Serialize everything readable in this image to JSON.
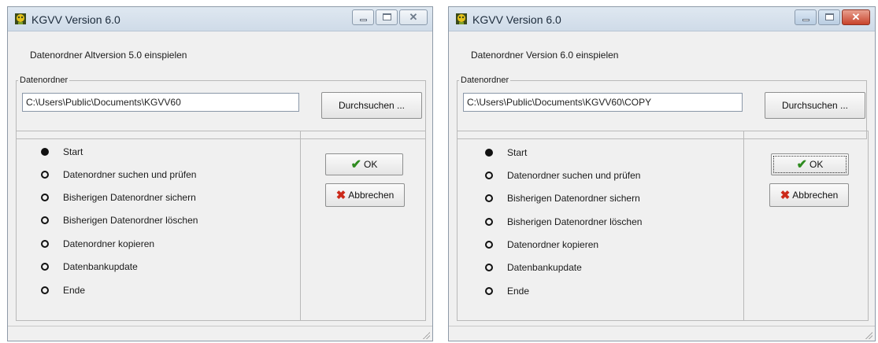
{
  "windows": [
    {
      "title": "KGVV Version 6.0",
      "subtitle": "Datenordner Altversion 5.0 einspielen",
      "group_label": "Datenordner",
      "folder_path": "C:\\Users\\Public\\Documents\\KGVV60",
      "browse_label": "Durchsuchen ...",
      "ok_label": "OK",
      "cancel_label": "Abbrechen",
      "steps": [
        {
          "label": "Start",
          "active": true
        },
        {
          "label": "Datenordner suchen und prüfen",
          "active": false
        },
        {
          "label": "Bisherigen Datenordner sichern",
          "active": false
        },
        {
          "label": "Bisherigen Datenordner löschen",
          "active": false
        },
        {
          "label": "Datenordner kopieren",
          "active": false
        },
        {
          "label": "Datenbankupdate",
          "active": false
        },
        {
          "label": "Ende",
          "active": false
        }
      ]
    },
    {
      "title": "KGVV Version 6.0",
      "subtitle": "Datenordner Version 6.0 einspielen",
      "group_label": "Datenordner",
      "folder_path": "C:\\Users\\Public\\Documents\\KGVV60\\COPY",
      "browse_label": "Durchsuchen ...",
      "ok_label": "OK",
      "cancel_label": "Abbrechen",
      "steps": [
        {
          "label": "Start",
          "active": true
        },
        {
          "label": "Datenordner suchen und prüfen",
          "active": false
        },
        {
          "label": "Bisherigen Datenordner sichern",
          "active": false
        },
        {
          "label": "Bisherigen Datenordner löschen",
          "active": false
        },
        {
          "label": "Datenordner kopieren",
          "active": false
        },
        {
          "label": "Datenbankupdate",
          "active": false
        },
        {
          "label": "Ende",
          "active": false
        }
      ]
    }
  ],
  "icons": {
    "app": "kgvv-app-icon",
    "minimize": "minimize-icon",
    "maximize": "maximize-icon",
    "close": "close-icon",
    "ok": "checkmark-icon",
    "cancel": "red-x-icon",
    "resize": "resize-grip-icon"
  },
  "colors": {
    "checkmark": "#2e8b1f",
    "cancel_x": "#cc2a1a",
    "close_button_active": "#c8432b"
  }
}
